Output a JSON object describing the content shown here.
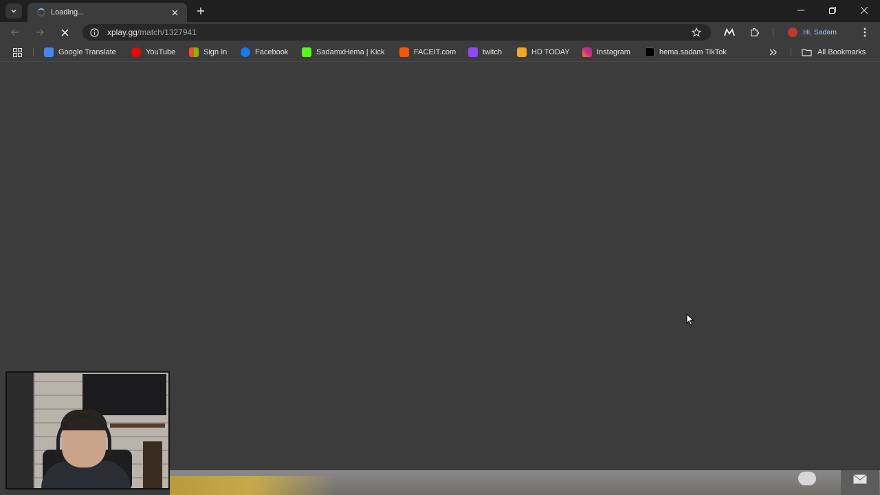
{
  "tab": {
    "title": "Loading..."
  },
  "toolbar": {
    "url_host": "xplay.gg",
    "url_path": "/match/1327941",
    "profile_label": "Hi, Sadam"
  },
  "bookmarks": [
    {
      "label": "Google Translate",
      "color": "#4285f4"
    },
    {
      "label": "YouTube",
      "color": "#ff0000"
    },
    {
      "label": "Sign In",
      "color": "#f25022"
    },
    {
      "label": "Facebook",
      "color": "#1877f2"
    },
    {
      "label": "SadamxHema | Kick",
      "color": "#53fc18"
    },
    {
      "label": "FACEIT.com",
      "color": "#ff5500"
    },
    {
      "label": "twitch",
      "color": "#9146ff"
    },
    {
      "label": "HD TODAY",
      "color": "#f5a623"
    },
    {
      "label": "Instagram",
      "color": "#e1306c"
    },
    {
      "label": "hema.sadam TikTok",
      "color": "#000000"
    }
  ],
  "bookmarks_all": "All Bookmarks"
}
